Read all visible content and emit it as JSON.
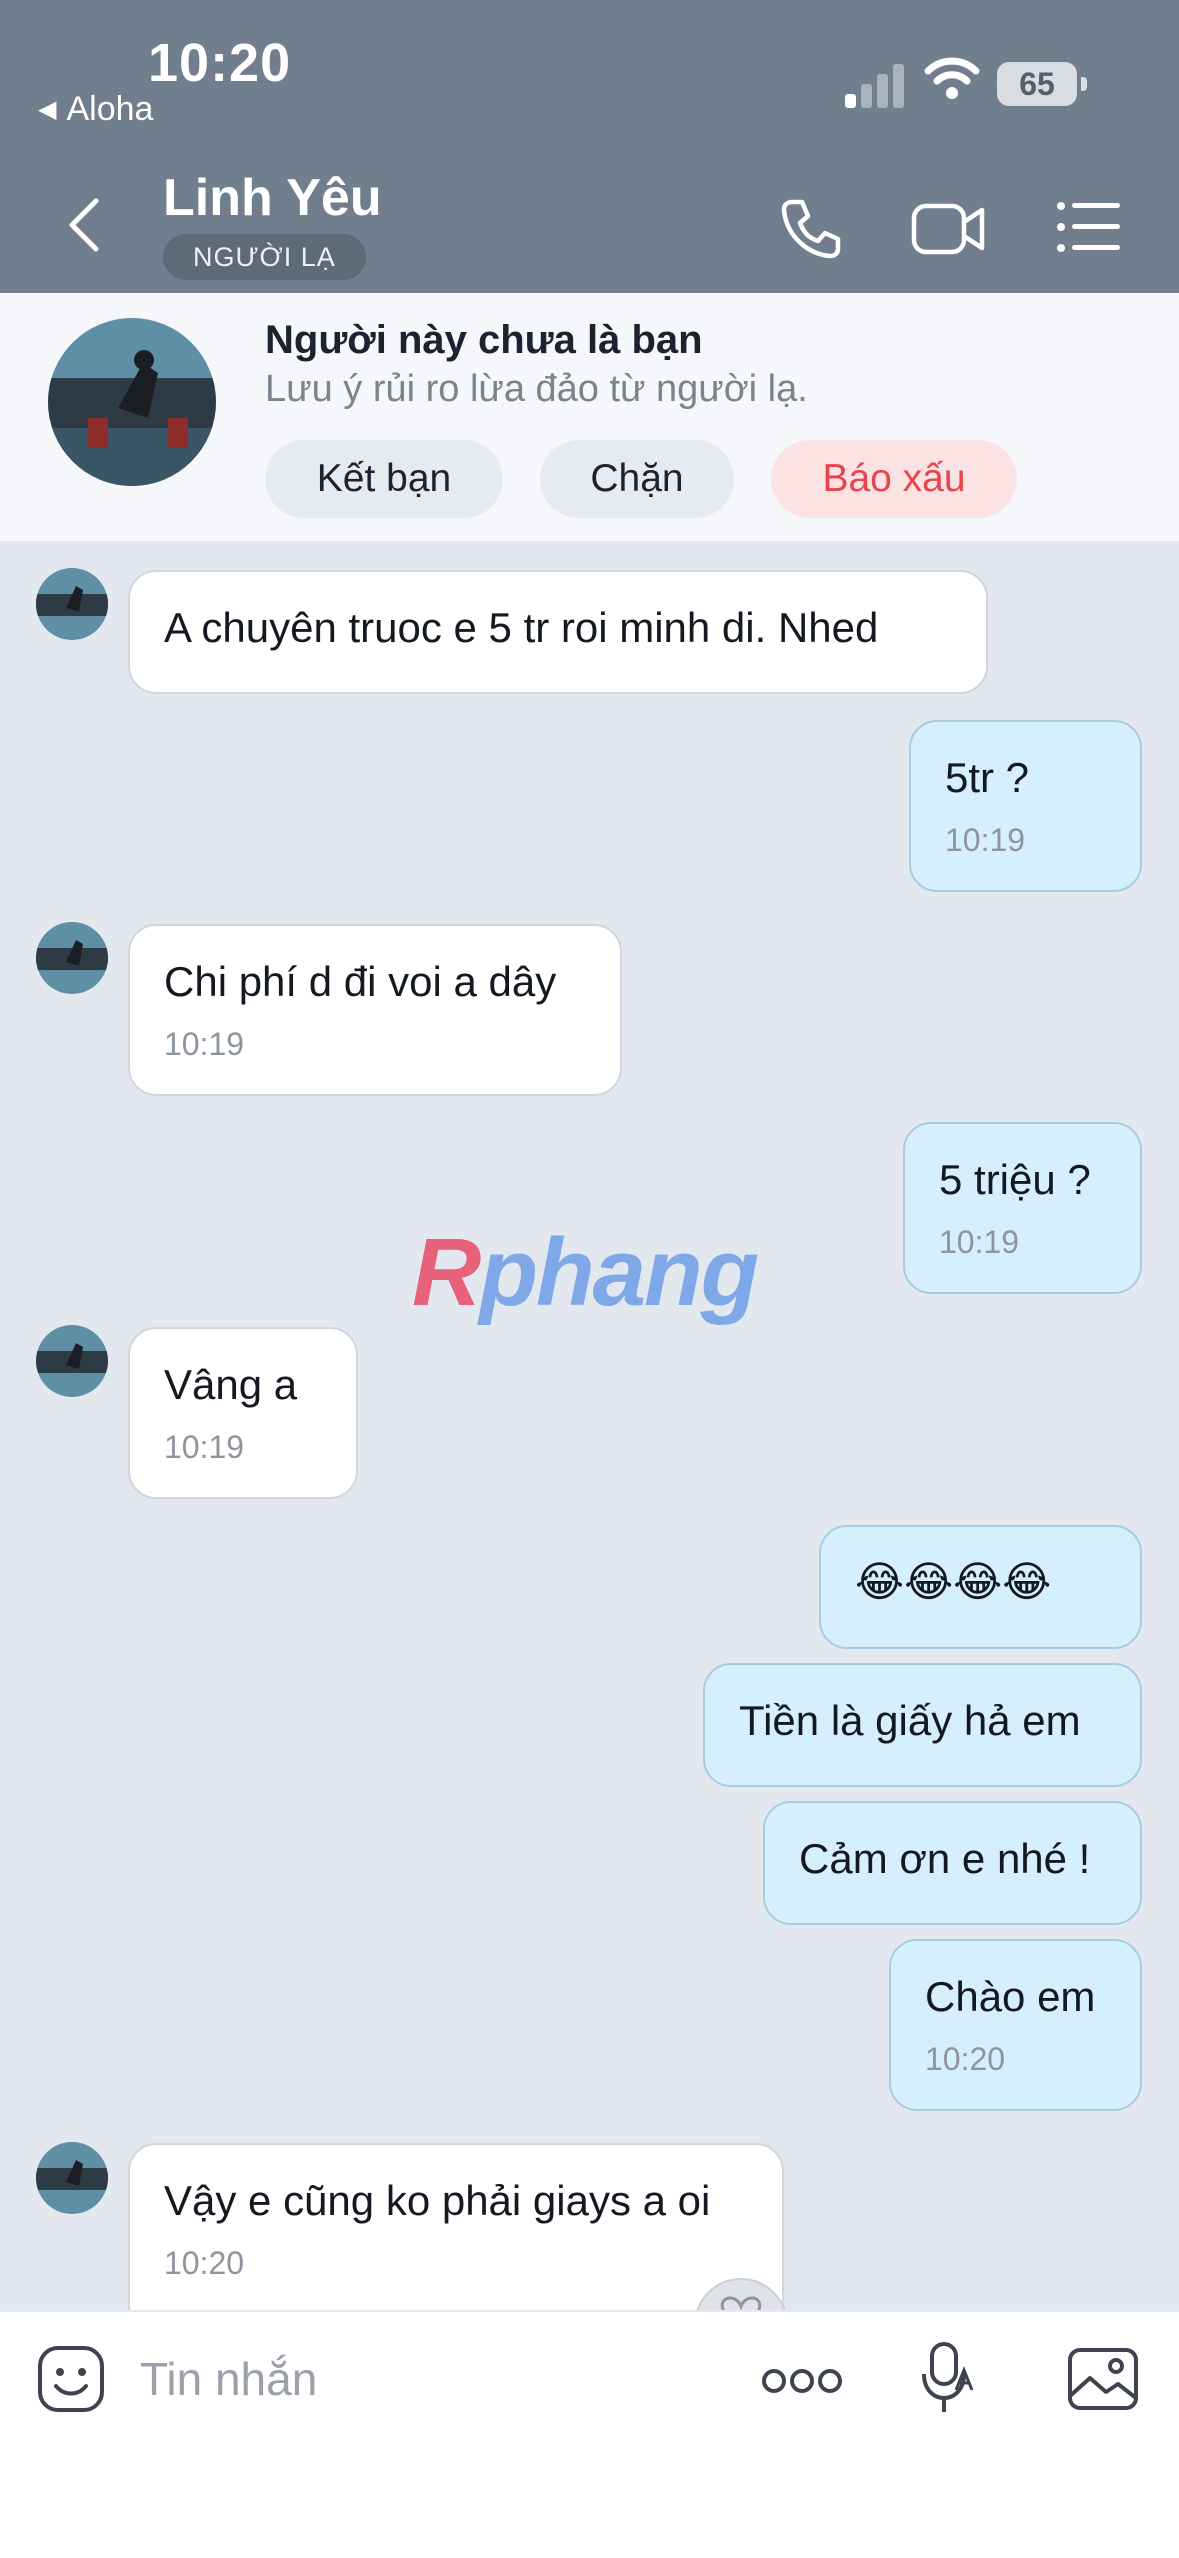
{
  "status_bar": {
    "time": "10:20",
    "back_app": "Aloha",
    "battery": "65"
  },
  "header": {
    "contact_name": "Linh Yêu",
    "badge": "NGƯỜI LẠ"
  },
  "stranger_banner": {
    "title": "Người này chưa là bạn",
    "subtitle": "Lưu ý rủi ro lừa đảo từ người lạ.",
    "add_friend": "Kết bạn",
    "block": "Chặn",
    "report": "Báo xấu"
  },
  "messages": [
    {
      "direction": "incoming",
      "text": "A chuyên truoc e 5 tr roi minh di. Nhed",
      "time": ""
    },
    {
      "direction": "outgoing",
      "text": "5tr ?",
      "time": "10:19"
    },
    {
      "direction": "incoming",
      "text": "Chi phí d đi voi a dây",
      "time": "10:19"
    },
    {
      "direction": "outgoing",
      "text": "5 triệu ?",
      "time": "10:19"
    },
    {
      "direction": "incoming",
      "text": "Vâng a",
      "time": "10:19"
    },
    {
      "direction": "outgoing",
      "text": "😂😂😂😂",
      "time": ""
    },
    {
      "direction": "outgoing",
      "text": "Tiền là giấy hả em",
      "time": ""
    },
    {
      "direction": "outgoing",
      "text": "Cảm ơn e nhé !",
      "time": ""
    },
    {
      "direction": "outgoing",
      "text": "Chào em",
      "time": "10:20"
    },
    {
      "direction": "incoming",
      "text": "Vậy e cũng ko phải giays a oi",
      "time": "10:20"
    }
  ],
  "watermark": {
    "first_letter": "R",
    "rest": "phang"
  },
  "composer": {
    "placeholder": "Tin nhắn"
  },
  "colors": {
    "header_bg": "#717e8d",
    "outgoing_bubble": "#d6effd",
    "incoming_bubble": "#ffffff",
    "chat_bg": "#e3e8ef",
    "report_red": "#e6454d"
  }
}
